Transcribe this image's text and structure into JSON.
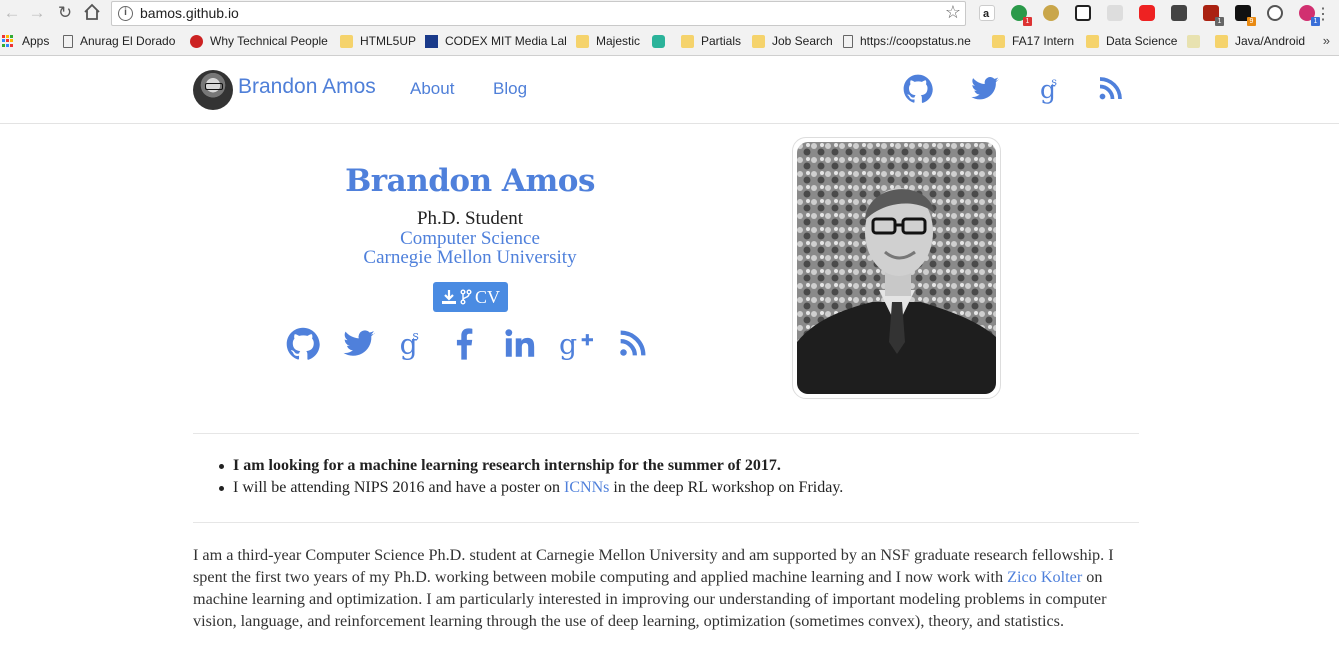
{
  "browser": {
    "url": "bamos.github.io",
    "bookmarks": [
      {
        "label": "Apps",
        "icon": "apps-icon"
      },
      {
        "label": "Anurag El Dorado",
        "icon": "page-icon"
      },
      {
        "label": "Why Technical People",
        "icon": "site-icon"
      },
      {
        "label": "HTML5UP",
        "icon": "folder-icon"
      },
      {
        "label": "CODEX MIT Media Lal",
        "icon": "site-icon"
      },
      {
        "label": "Majestic",
        "icon": "folder-icon"
      },
      {
        "label": "",
        "icon": "site-icon"
      },
      {
        "label": "Partials",
        "icon": "folder-icon"
      },
      {
        "label": "Job Search",
        "icon": "folder-icon"
      },
      {
        "label": "https://coopstatus.ne",
        "icon": "page-icon"
      },
      {
        "label": "FA17 Intern",
        "icon": "folder-icon"
      },
      {
        "label": "Data Science",
        "icon": "folder-icon"
      },
      {
        "label": "",
        "icon": "site-icon"
      },
      {
        "label": "Java/Android",
        "icon": "folder-icon"
      }
    ],
    "extension_badges": [
      "1",
      "1",
      "1",
      "9",
      "1"
    ],
    "more_bookmarks": "»"
  },
  "site": {
    "brand": "Brandon Amos",
    "nav": [
      "About",
      "Blog"
    ],
    "top_social_icons": [
      "github-icon",
      "twitter-icon",
      "google-scholar-icon",
      "rss-icon"
    ]
  },
  "hero": {
    "name": "Brandon Amos",
    "role": "Ph.D. Student",
    "department": "Computer Science",
    "university": "Carnegie Mellon University",
    "cv_label": "CV",
    "social_icons": [
      "github-icon",
      "twitter-icon",
      "google-scholar-icon",
      "facebook-icon",
      "linkedin-icon",
      "google-plus-icon",
      "rss-icon"
    ]
  },
  "news": {
    "item1": "I am looking for a machine learning research internship for the summer of 2017.",
    "item2_before": "I will be attending NIPS 2016 and have a poster on ",
    "item2_link": "ICNNs",
    "item2_after": " in the deep RL workshop on Friday."
  },
  "bio": {
    "before_link": "I am a third-year Computer Science Ph.D. student at Carnegie Mellon University and am supported by an NSF graduate research fellowship. I spent the first two years of my Ph.D. working between mobile computing and applied machine learning and I now work with ",
    "link": "Zico Kolter",
    "after_link": " on machine learning and optimization. I am particularly interested in improving our understanding of important modeling problems in computer vision, language, and reinforcement learning through the use of deep learning, optimization (sometimes convex), theory, and statistics."
  },
  "colors": {
    "accent": "#4f80db",
    "cv_button": "#4a8be2"
  }
}
